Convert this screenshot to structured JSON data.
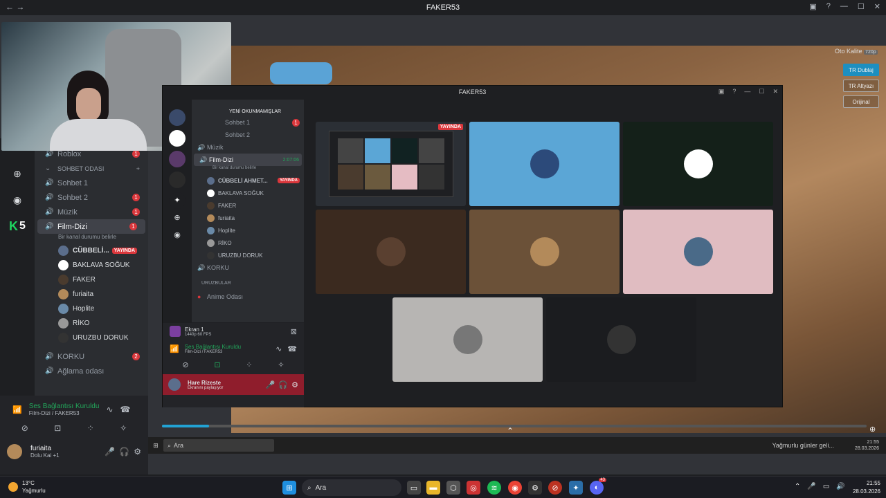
{
  "window": {
    "title": "FAKER53"
  },
  "inner_window": {
    "title": "FAKER53"
  },
  "server_list": {
    "number_badge": "5"
  },
  "channels": [
    {
      "name": "Roblox",
      "badge": "1"
    },
    {
      "name": "SOHBET ODASI",
      "category": true
    },
    {
      "name": "Sohbet 1",
      "badge": ""
    },
    {
      "name": "Sohbet 2",
      "badge": "1"
    },
    {
      "name": "Müzik",
      "badge": "1"
    },
    {
      "name": "Film-Dizi",
      "badge": "1",
      "selected": true
    }
  ],
  "channel_status": "Bir kanal durumu belirle",
  "voice_users": [
    {
      "name": "CÜBBELİ...",
      "live": "YAYINDA",
      "color": "#5b6e8c"
    },
    {
      "name": "BAKLAVA SOĞUK",
      "color": "#ffffff"
    },
    {
      "name": "FAKER",
      "color": "#4a3b2e"
    },
    {
      "name": "furiaita",
      "color": "#b38a5a"
    },
    {
      "name": "Hoplite",
      "color": "#6a8aa8"
    },
    {
      "name": "RİKO",
      "color": "#999999"
    },
    {
      "name": "URUZBU DORUK",
      "color": "#333333"
    }
  ],
  "more_channels": [
    {
      "name": "KORKU",
      "badge": "2"
    },
    {
      "name": "Ağlama odası",
      "badge": ""
    }
  ],
  "voice_panel": {
    "status": "Ses Bağlantısı Kuruldu",
    "sub": "Film-Dizi / FAKER53"
  },
  "user_panel": {
    "name": "furiaita",
    "status": "Dolu Kai +1"
  },
  "stream_overlay": {
    "auto_label": "Oto Kalite",
    "quality": "720p",
    "lang_buttons": [
      "TR Dublaj",
      "TR Altyazı",
      "Orijinal"
    ]
  },
  "inner_channels": {
    "unread": "YENİ OKUNMAMIŞLAR",
    "rows": [
      {
        "name": "Sohbet 1",
        "badge": "1"
      },
      {
        "name": "Sohbet 2",
        "badge": ""
      },
      {
        "name": "Müzik",
        "badge": ""
      },
      {
        "name": "Film-Dizi",
        "time": "2:07:06"
      }
    ],
    "status": "Bir kanal durumu belirle",
    "users": [
      {
        "name": "CÜBBELİ AHMET...",
        "live": "YAYINDA",
        "color": "#5b6e8c"
      },
      {
        "name": "BAKLAVA SOĞUK",
        "color": "#ffffff"
      },
      {
        "name": "FAKER",
        "color": "#4a3b2e"
      },
      {
        "name": "furiaita",
        "color": "#b38a5a"
      },
      {
        "name": "Hoplite",
        "color": "#6a8aa8"
      },
      {
        "name": "RİKO",
        "color": "#999999"
      },
      {
        "name": "URUZBU DORUK",
        "color": "#333333"
      }
    ],
    "korku": "KORKU",
    "category": "URUZBULAR",
    "anime": "Anime Odası"
  },
  "inner_panel": {
    "screen": "Ekran 1",
    "screen_sub": "1440p 60 FPS",
    "voice_status": "Ses Bağlantısı Kuruldu",
    "voice_sub": "Film-Dizi / FAKER53",
    "user": "Hare Rizeste",
    "user_sub": "Ekranını paylaşıyor"
  },
  "stream_tiles": {
    "live_label": "YAYINDA"
  },
  "win_task": {
    "search": "Ara",
    "notice": "Yağmurlu günler geli...",
    "time": "21:55",
    "date": "28.03.2026"
  },
  "taskbar": {
    "weather_temp": "13°C",
    "weather_desc": "Yağmurlu",
    "search": "Ara",
    "time": "21:55",
    "date": "28.03.2026",
    "discord_badge": "43"
  }
}
